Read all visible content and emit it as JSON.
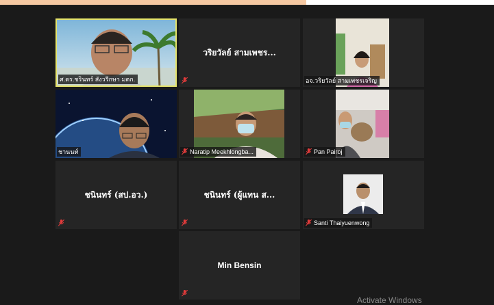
{
  "participants": [
    {
      "name": "ศ.ดร.ชรินทร์ สังวรีกษา มตก.",
      "muted": false,
      "speaking": true
    },
    {
      "name": "วริยวัลย์ สามเพชร...",
      "muted": true
    },
    {
      "name": "อจ.วริยวัลย์ สามเพชรเจริญ",
      "muted": false
    },
    {
      "name": "ชานนท์",
      "muted": false
    },
    {
      "name": "Naratip Meekhlongba...",
      "muted": true
    },
    {
      "name": "Pan Pairoj",
      "muted": true
    },
    {
      "name": "ชนินทร์ (สป.อว.)",
      "muted": true
    },
    {
      "name": "ชนินทร์ (ผู้แทน ส...",
      "muted": true
    },
    {
      "name": "Santi Thaiyuenwong",
      "muted": true
    },
    {
      "name": "Min Bensin",
      "muted": true
    }
  ],
  "watermark": "Activate Windows",
  "colors": {
    "speaking_border": "#e6e46a",
    "mute_icon": "#e23b3b",
    "tile_bg": "#252525"
  }
}
